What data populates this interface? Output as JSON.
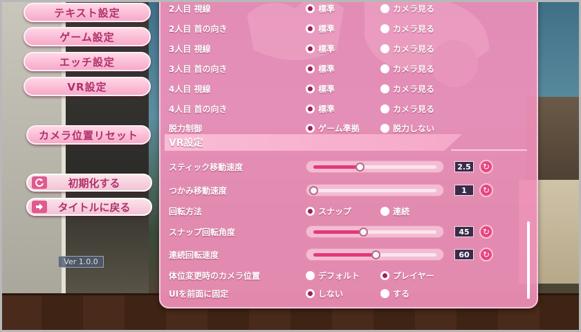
{
  "left_menu": {
    "buttons": [
      "テキスト設定",
      "ゲーム設定",
      "エッチ設定",
      "VR設定"
    ],
    "camera_reset": "カメラ位置リセット",
    "initialize": "初期化する",
    "back_to_title": "タイトルに戻る",
    "version": "Ver 1.0.0"
  },
  "panel": {
    "gaze_rows": [
      {
        "label": "2人目 視線",
        "opt1": "標準",
        "opt2": "カメラ見る",
        "selected": 1
      },
      {
        "label": "2人目 首の向き",
        "opt1": "標準",
        "opt2": "カメラ見る",
        "selected": 1
      },
      {
        "label": "3人目 視線",
        "opt1": "標準",
        "opt2": "カメラ見る",
        "selected": 1
      },
      {
        "label": "3人目 首の向き",
        "opt1": "標準",
        "opt2": "カメラ見る",
        "selected": 1
      },
      {
        "label": "4人目 視線",
        "opt1": "標準",
        "opt2": "カメラ見る",
        "selected": 1
      },
      {
        "label": "4人目 首の向き",
        "opt1": "標準",
        "opt2": "カメラ見る",
        "selected": 1
      },
      {
        "label": "脱力制御",
        "opt1": "ゲーム準拠",
        "opt2": "脱力しない",
        "selected": 1
      }
    ],
    "section_title": "VR設定",
    "stick_speed": {
      "label": "スティック移動速度",
      "value": "2.5",
      "fraction": 0.37
    },
    "grab_speed": {
      "label": "つかみ移動速度",
      "value": "1",
      "fraction": 0.0
    },
    "rotation_method": {
      "label": "回転方法",
      "opt1": "スナップ",
      "opt2": "連続",
      "selected": 1
    },
    "snap_angle": {
      "label": "スナップ回転角度",
      "value": "45",
      "fraction": 0.4
    },
    "continuous_speed": {
      "label": "連続回転速度",
      "value": "60",
      "fraction": 0.5
    },
    "camera_on_position_change": {
      "label": "体位変更時のカメラ位置",
      "opt1": "デフォルト",
      "opt2": "プレイヤー",
      "selected": 2
    },
    "ui_fixed_front": {
      "label": "UIを前面に固定",
      "opt1": "しない",
      "opt2": "する",
      "selected": 1
    }
  },
  "colors": {
    "accent": "#e4387a",
    "panel": "#ef8fb9",
    "button_text": "#b0306b"
  }
}
